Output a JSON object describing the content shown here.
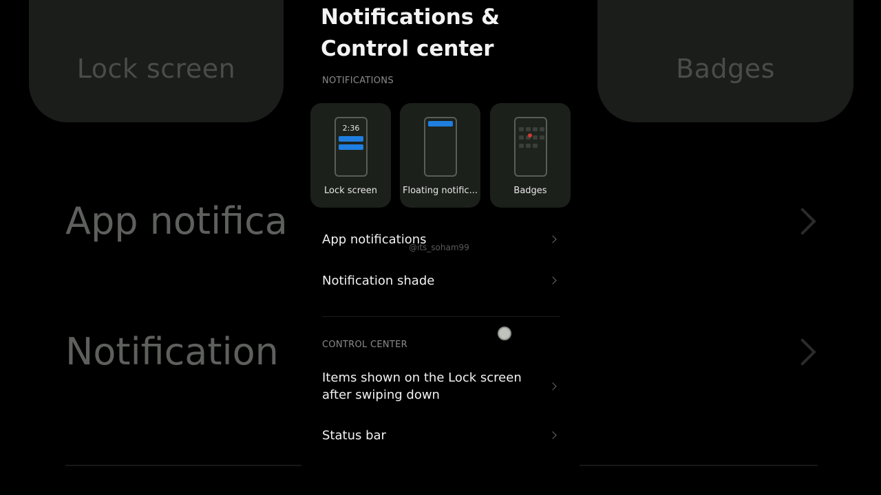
{
  "background": {
    "left_card_label": "Lock screen",
    "right_card_label": "Badges",
    "row1_label": "App notifica",
    "row2_label": "Notification"
  },
  "page": {
    "title": "Notifications & Control center"
  },
  "notifications": {
    "header": "NOTIFICATIONS",
    "tiles": [
      {
        "label": "Lock screen",
        "preview_time": "2:36",
        "icon": "lock-screen-preview"
      },
      {
        "label": "Floating notific...",
        "icon": "floating-notification-preview"
      },
      {
        "label": "Badges",
        "icon": "badges-preview"
      }
    ],
    "rows": [
      {
        "label": "App notifications"
      },
      {
        "label": "Notification shade"
      }
    ]
  },
  "control_center": {
    "header": "CONTROL CENTER",
    "rows": [
      {
        "label": "Items shown on the Lock screen after swiping down"
      },
      {
        "label": "Status bar"
      }
    ]
  },
  "watermark": "@its_soham99",
  "colors": {
    "accent_blue": "#1f7ee0",
    "badge_red": "#d13a30",
    "tile_bg": "#1c201b"
  }
}
